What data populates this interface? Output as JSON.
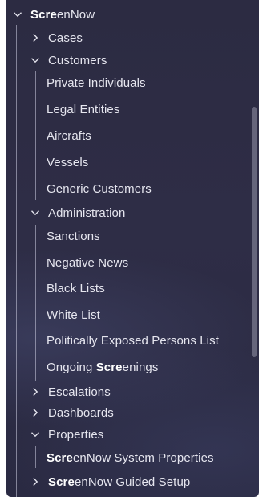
{
  "tree": {
    "root": {
      "hl": "Scre",
      "rest": "enNow"
    },
    "cases": "Cases",
    "customers": {
      "label": "Customers",
      "children": [
        "Private Individuals",
        "Legal Entities",
        "Aircrafts",
        "Vessels",
        "Generic Customers"
      ]
    },
    "administration": {
      "label": "Administration",
      "children": [
        "Sanctions",
        "Negative News",
        "Black Lists",
        "White List",
        "Politically Exposed Persons List"
      ],
      "ongoing": {
        "pre": "Ongoing ",
        "hl": "Scre",
        "rest": "enings"
      }
    },
    "escalations": "Escalations",
    "dashboards": "Dashboards",
    "properties": {
      "label": "Properties",
      "system": {
        "hl": "Scre",
        "rest": "enNow System Properties"
      }
    },
    "guided_setup": {
      "hl": "Scre",
      "rest": "enNow Guided Setup"
    }
  },
  "icons": {
    "expanded": "chevron-down-icon",
    "collapsed": "chevron-right-icon"
  }
}
